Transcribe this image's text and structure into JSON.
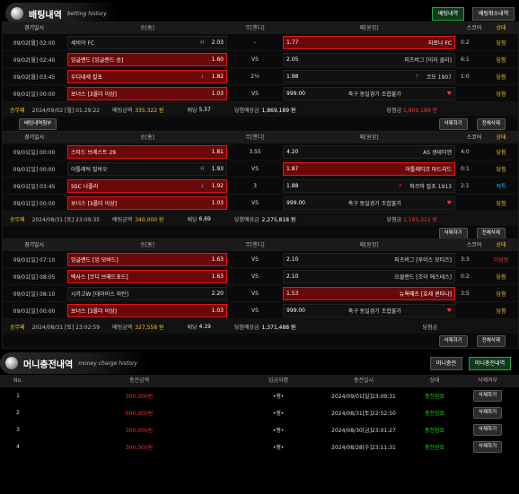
{
  "betting": {
    "title": "배팅내역",
    "subtitle": "betting history",
    "tabs": [
      "배팅내역",
      "배팅취소내역"
    ],
    "columns": [
      "경기일시",
      "승[홈]",
      "무[핸디]",
      "패[원정]",
      "스코어",
      "상태"
    ],
    "tickets": [
      {
        "rows": [
          {
            "date": "09/02[월] 02:00",
            "home": "세비야 FC",
            "home_odds": "2.03",
            "home_flag": "H",
            "draw": "-",
            "away": "지로나 FC",
            "away_odds": "1.77",
            "score": "0:2",
            "result": "당첨",
            "selected": "away"
          },
          {
            "date": "09/02[월] 02:40",
            "home": "잉글랜드 [잉글랜드 승]",
            "home_odds": "1.60",
            "home_flag": "",
            "draw": "VS",
            "away": "피츠버그 [이자 클라]",
            "away_odds": "2.05",
            "score": "6:1",
            "result": "당첨",
            "selected": "home"
          },
          {
            "date": "09/02[월] 03:45",
            "home": "우디네세 칼초",
            "home_odds": "1.82",
            "home_flag": "↓",
            "draw": "2½",
            "away": "코모 1907",
            "away_odds": "1.98",
            "away_flag": "↑",
            "score": "1:0",
            "result": "당첨",
            "selected": "home"
          },
          {
            "date": "09/01[일] 00:00",
            "home": "보너스 [3폴더 이상]",
            "home_odds": "1.03",
            "home_flag": "",
            "draw": "VS",
            "away": "축구 동일경기 조합불가",
            "away_odds": "999.00",
            "score": "",
            "result": "당첨",
            "selected": "home",
            "bonus": true
          }
        ],
        "summary": {
          "label": "승무패",
          "time": "2024/09/02 [월] 01:29:22",
          "bet_label": "배팅금액",
          "bet": "335,322 원",
          "odds_label": "배당",
          "odds": "5.57",
          "expect_label": "당첨예상금",
          "expect": "1,869,189 원",
          "win_label": "당첨금",
          "win": "1,869,189 원"
        },
        "buttons": {
          "left": "배팅내역첨부",
          "delete": "삭제하기",
          "select": "전체삭제"
        }
      },
      {
        "rows": [
          {
            "date": "09/01[일] 00:00",
            "home": "스타드 브레스트 29",
            "home_odds": "1.81",
            "home_flag": "",
            "draw": "3.55",
            "away": "AS 생테티엔",
            "away_odds": "4.20",
            "score": "4:0",
            "result": "당첨",
            "selected": "home"
          },
          {
            "date": "09/01[일] 00:00",
            "home": "아틀레틱 빌바오",
            "home_odds": "1.93",
            "home_flag": "H",
            "draw": "VS",
            "away": "아틀레티코 마드리드",
            "away_odds": "1.87",
            "score": "0:1",
            "result": "당첨",
            "selected": "away"
          },
          {
            "date": "09/01[일] 03:45",
            "home": "SSC 나폴리",
            "home_odds": "1.92",
            "home_flag": "↓",
            "draw": "3",
            "away": "파르마 칼초 1913",
            "away_odds": "1.88",
            "away_flag": "↑",
            "score": "2:1",
            "result": "적특",
            "selected": "home"
          },
          {
            "date": "09/01[일] 00:00",
            "home": "보너스 [3폴더 이상]",
            "home_odds": "1.03",
            "home_flag": "",
            "draw": "VS",
            "away": "축구 동일경기 조합불가",
            "away_odds": "999.00",
            "score": "",
            "result": "당첨",
            "selected": "home",
            "bonus": true
          }
        ],
        "summary": {
          "label": "승무패",
          "time": "2024/08/31 [토] 23:09:35",
          "bet_label": "배팅금액",
          "bet": "340,000 원",
          "odds_label": "배당",
          "odds": "6.69",
          "expect_label": "당첨예상금",
          "expect": "2,275,818 원",
          "win_label": "당첨금",
          "win": "1,185,322 원"
        },
        "buttons": {
          "left": "",
          "delete": "삭제하기",
          "select": "전체삭제"
        }
      },
      {
        "rows": [
          {
            "date": "09/01[일] 07:10",
            "home": "잉글랜드 [잉 모바드]",
            "home_odds": "1.63",
            "home_flag": "",
            "draw": "VS",
            "away": "피츠버그 [루이스 모티즈]",
            "away_odds": "2.10",
            "score": "3:3",
            "result": "미당첨",
            "selected": "home"
          },
          {
            "date": "09/01[일] 08:05",
            "home": "텍사스 [코디 브래드포드]",
            "home_odds": "1.63",
            "home_flag": "",
            "draw": "VS",
            "away": "오클랜드 [조이 에스테스]",
            "away_odds": "2.10",
            "score": "0:2",
            "result": "당첨",
            "selected": "home"
          },
          {
            "date": "09/01[일] 08:10",
            "home": "시카고W [데이비스 마탄]",
            "home_odds": "2.20",
            "home_flag": "",
            "draw": "VS",
            "away": "뉴욕메츠 [호세 퀸타나]",
            "away_odds": "1.53",
            "score": "3:5",
            "result": "당첨",
            "selected": "away"
          },
          {
            "date": "09/01[일] 00:00",
            "home": "보너스 [3폴더 이상]",
            "home_odds": "1.03",
            "home_flag": "",
            "draw": "VS",
            "away": "축구 동일경기 조합불가",
            "away_odds": "999.00",
            "score": "",
            "result": "당첨",
            "selected": "home",
            "bonus": true
          }
        ],
        "summary": {
          "label": "승무패",
          "time": "2024/08/31 [토] 23:02:59",
          "bet_label": "배팅금액",
          "bet": "327,558 원",
          "odds_label": "배당",
          "odds": "4.19",
          "expect_label": "당첨예상금",
          "expect": "1,371,488 원",
          "win_label": "당첨금",
          "win": ""
        },
        "buttons": {
          "left": "",
          "delete": "삭제하기",
          "select": "전체삭제"
        }
      }
    ]
  },
  "money": {
    "title": "머니충전내역",
    "subtitle": "money charge history",
    "tabs": [
      "머니충전",
      "머니충전내역"
    ],
    "columns": [
      "No.",
      "충전금액",
      "입금자명",
      "충전일시",
      "상태",
      "삭제여부"
    ],
    "rows": [
      {
        "no": "1",
        "amount": "300,000원",
        "depositor": "•쟁•",
        "time": "2024/09/01[일]23:09:31",
        "status": "충전완료",
        "action": "삭제하기"
      },
      {
        "no": "2",
        "amount": "600,000원",
        "depositor": "•쟁•",
        "time": "2024/08/31[토]22:52:50",
        "status": "충전완료",
        "action": "삭제하기"
      },
      {
        "no": "3",
        "amount": "300,000원",
        "depositor": "•쟁•",
        "time": "2024/08/30[금]23:01:27",
        "status": "충전완료",
        "action": "삭제하기"
      },
      {
        "no": "4",
        "amount": "300,000원",
        "depositor": "•쟁•",
        "time": "2024/08/28[수]23:11:31",
        "status": "충전완료",
        "action": "삭제하기"
      }
    ]
  },
  "colors": {
    "accent": "#22aa44",
    "selected": "#6b0808",
    "win": "#f0c419",
    "loss": "#e33333"
  },
  "icons": {
    "header": "ball-icon",
    "home": "home-marker-icon",
    "up": "arrow-up-icon",
    "down": "arrow-down-icon",
    "heart": "heart-icon"
  }
}
